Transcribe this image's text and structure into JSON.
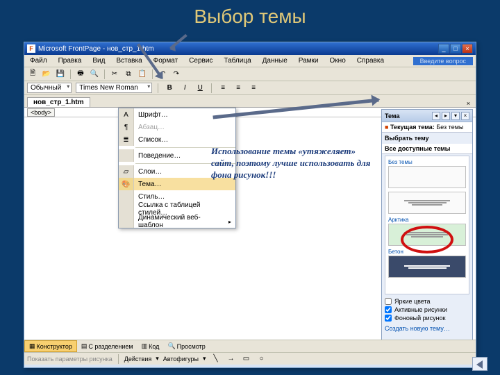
{
  "slide": {
    "title": "Выбор темы",
    "note": "Использование темы «утяжеляет» сайт, поэтому лучше использовать для фона рисунок!!!"
  },
  "titlebar": {
    "app": "Microsoft FrontPage",
    "doc": "нов_стр_1.htm"
  },
  "menu": {
    "file": "Файл",
    "edit": "Правка",
    "view": "Вид",
    "insert": "Вставка",
    "format": "Формат",
    "tools": "Сервис",
    "table": "Таблица",
    "data": "Данные",
    "frames": "Рамки",
    "window": "Окно",
    "help": "Справка",
    "question": "Введите вопрос"
  },
  "format_menu": {
    "font": "Шрифт…",
    "paragraph": "Абзац…",
    "list": "Список…",
    "behavior": "Поведение…",
    "layers": "Слои…",
    "theme": "Тема…",
    "style": "Стиль…",
    "css": "Ссылка с таблицей стилей…",
    "dwt": "Динамический веб-шаблон"
  },
  "fmt": {
    "style": "Обычный",
    "font": "Times New Roman"
  },
  "tabs": {
    "file": "нов_стр_1.htm"
  },
  "breadcrumb": {
    "body": "<body>"
  },
  "viewtabs": {
    "design": "Конструктор",
    "split": "С разделением",
    "code": "Код",
    "preview": "Просмотр"
  },
  "drawbar": {
    "show": "Показать параметры рисунка",
    "actions": "Действия",
    "autoshapes": "Автофигуры"
  },
  "taskpane": {
    "title": "Тема",
    "current_label": "Текущая тема:",
    "current_value": "Без темы",
    "select": "Выбрать тему",
    "all": "Все доступные темы",
    "themes": {
      "none": "Без темы",
      "arctic": "Арктика",
      "concrete": "Бетон"
    },
    "checks": {
      "bright": "Яркие цвета",
      "active": "Активные рисунки",
      "bg": "Фоновый рисунок"
    },
    "new": "Создать новую тему…"
  }
}
